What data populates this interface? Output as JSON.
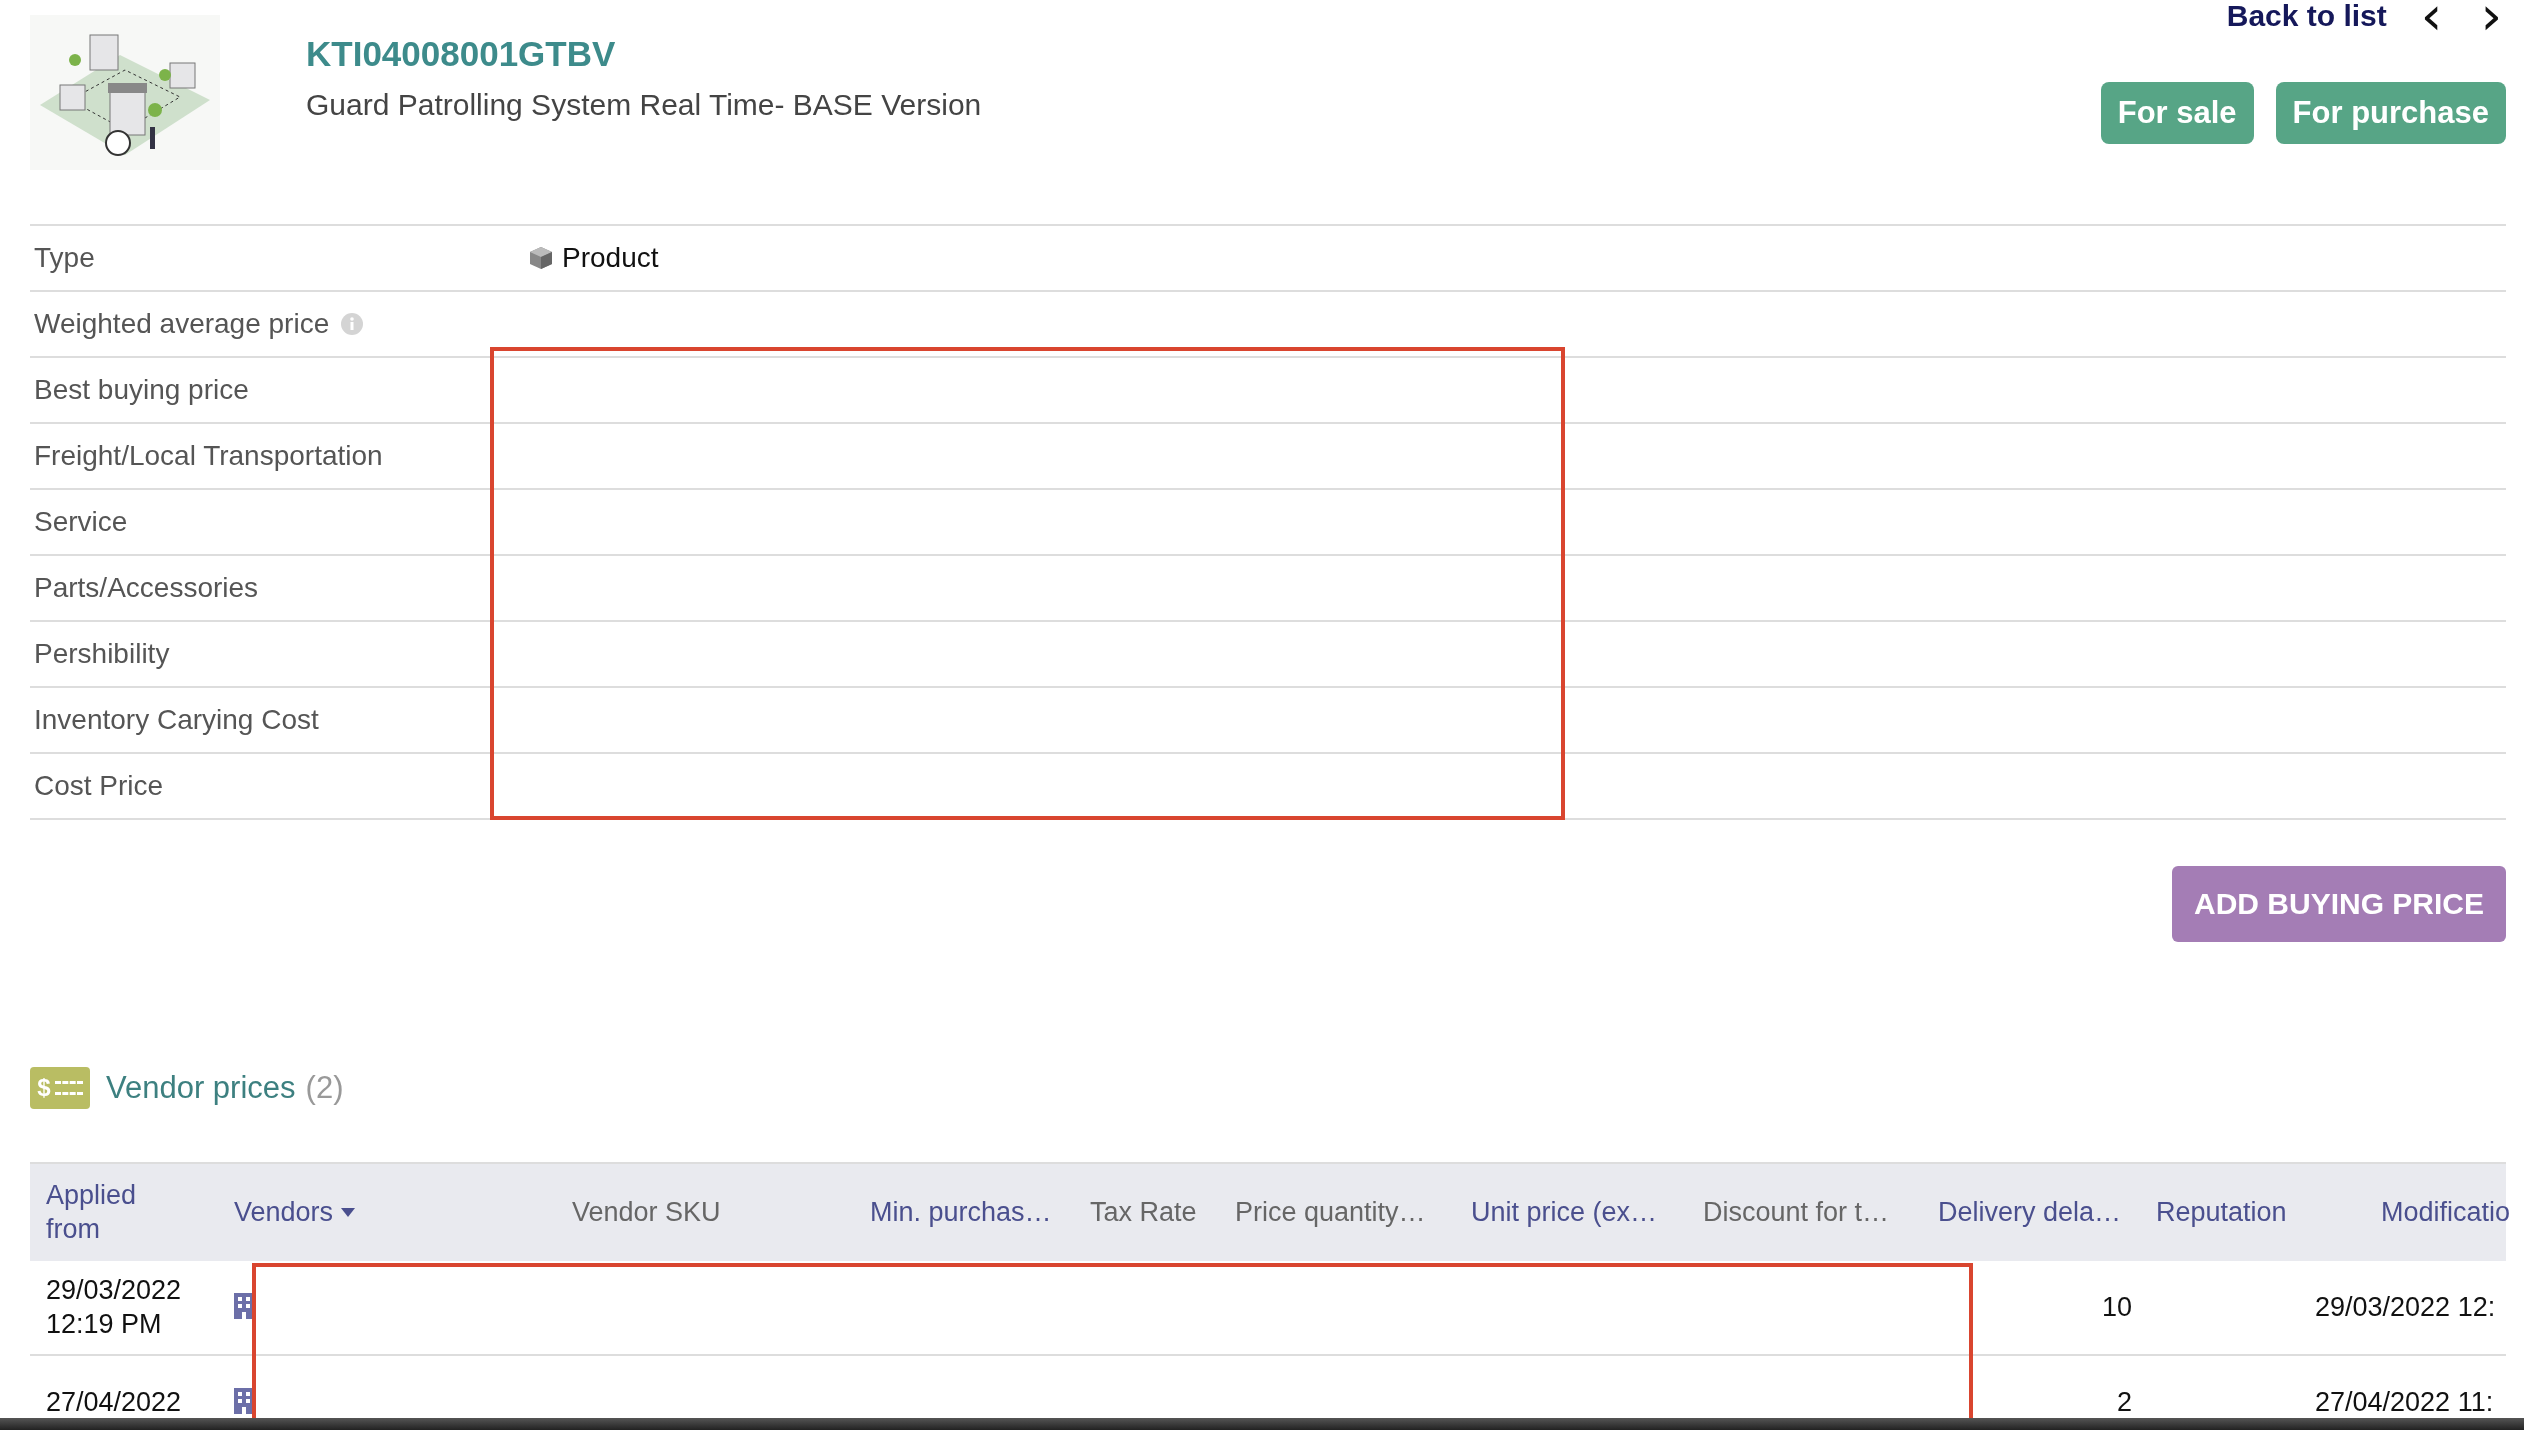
{
  "header": {
    "product_code": "KTI04008001GTBV",
    "product_name": "Guard Patrolling System Real Time- BASE Version",
    "back_link": "Back to list",
    "nav": [
      "‹",
      "›"
    ],
    "flags": [
      {
        "label": "For sale",
        "on": true
      },
      {
        "label": "For purchase",
        "on": true
      }
    ]
  },
  "fields": [
    {
      "label": "Type",
      "value": "Product",
      "kind": "product"
    },
    {
      "label": "Weighted average price",
      "kind": "info"
    },
    {
      "label": "Best buying price",
      "kind": "plain"
    },
    {
      "label": "Freight/Local Transportation",
      "kind": "plain"
    },
    {
      "label": "Service",
      "kind": "plain"
    },
    {
      "label": "Parts/Accessories",
      "kind": "plain"
    },
    {
      "label": "Pershibility",
      "kind": "plain"
    },
    {
      "label": "Inventory Carying Cost",
      "kind": "plain"
    },
    {
      "label": "Cost Price",
      "kind": "plain"
    }
  ],
  "add_button": "ADD BUYING PRICE",
  "vendor_prices": {
    "icon_text": "$",
    "title": "Vendor prices",
    "count": "(2)"
  },
  "table": {
    "columns": [
      {
        "label": "Applied from",
        "sortable": true
      },
      {
        "label": "Vendors",
        "sortable": true,
        "sorted": true
      },
      {
        "label": "Vendor SKU",
        "sortable": false
      },
      {
        "label": "Min. purchas…",
        "sortable": true
      },
      {
        "label": "Tax Rate",
        "sortable": false
      },
      {
        "label": "Price quantity…",
        "sortable": false
      },
      {
        "label": "Unit price (ex…",
        "sortable": true
      },
      {
        "label": "Discount for t…",
        "sortable": false
      },
      {
        "label": "Delivery dela…",
        "sortable": true
      },
      {
        "label": "Reputation",
        "sortable": true
      },
      {
        "label": "Modificatio",
        "sortable": true
      }
    ],
    "rows": [
      {
        "applied_from": [
          "29/03/2022",
          "12:19 PM"
        ],
        "delivery_delay": "10",
        "modified": "29/03/2022 12:"
      },
      {
        "applied_from": [
          "27/04/2022"
        ],
        "delivery_delay": "2",
        "modified": "27/04/2022 11:"
      }
    ]
  }
}
